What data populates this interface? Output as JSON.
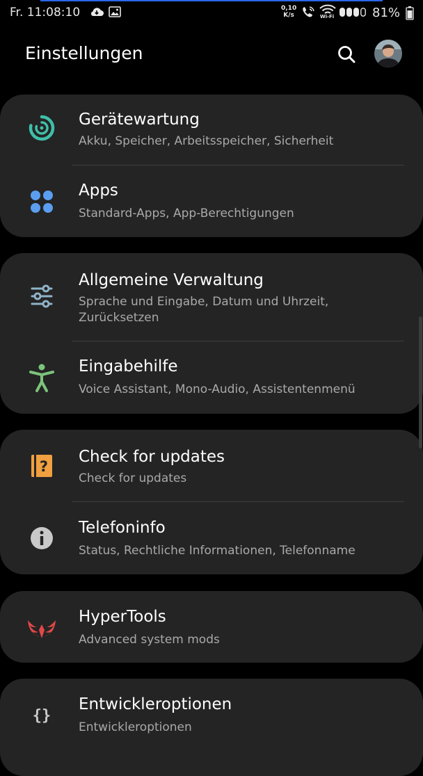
{
  "status_bar": {
    "time": "Fr. 11:08:10",
    "speed_value": "0,10",
    "speed_unit": "K/s",
    "wifi_label": "Wi-Fi",
    "battery": "81%"
  },
  "header": {
    "title": "Einstellungen"
  },
  "groups": [
    {
      "items": [
        {
          "title": "Gerätewartung",
          "subtitle": "Akku, Speicher, Arbeitsspeicher, Sicherheit",
          "icon": "device-care-icon",
          "icon_color": "#3fbfa8"
        },
        {
          "title": "Apps",
          "subtitle": "Standard-Apps, App-Berechtigungen",
          "icon": "apps-icon",
          "icon_color": "#5b9ef0"
        }
      ]
    },
    {
      "items": [
        {
          "title": "Allgemeine Verwaltung",
          "subtitle": "Sprache und Eingabe, Datum und Uhrzeit, Zurücksetzen",
          "icon": "sliders-icon",
          "icon_color": "#8fb3c8"
        },
        {
          "title": "Eingabehilfe",
          "subtitle": "Voice Assistant, Mono-Audio, Assistentenmenü",
          "icon": "accessibility-icon",
          "icon_color": "#7cc47c"
        }
      ]
    },
    {
      "items": [
        {
          "title": "Check for updates",
          "subtitle": "Check for updates",
          "icon": "update-manual-icon",
          "icon_color": "#f0a040"
        },
        {
          "title": "Telefoninfo",
          "subtitle": "Status, Rechtliche Informationen, Telefonname",
          "icon": "info-icon",
          "icon_color": "#c9c9c9"
        }
      ]
    },
    {
      "items": [
        {
          "title": "HyperTools",
          "subtitle": "Advanced system mods",
          "icon": "hypertools-wings-icon",
          "icon_color": "#e04848"
        }
      ]
    },
    {
      "items": [
        {
          "title": "Entwickleroptionen",
          "subtitle": "Entwickleroptionen",
          "icon": "braces-icon",
          "icon_color": "#c9c9c9"
        }
      ]
    }
  ]
}
